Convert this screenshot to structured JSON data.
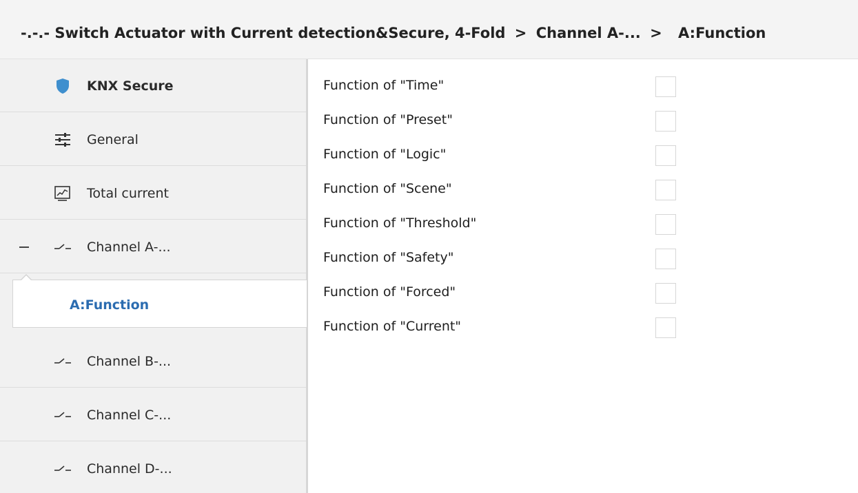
{
  "breadcrumb": {
    "device": "-.-.- Switch Actuator with Current detection&Secure, 4-Fold",
    "separator": ">",
    "channel": "Channel A-...",
    "current": "A:Function"
  },
  "sidebar": {
    "items": [
      {
        "label": "KNX Secure",
        "icon": "shield-icon"
      },
      {
        "label": "General",
        "icon": "sliders-icon"
      },
      {
        "label": "Total current",
        "icon": "chart-icon"
      },
      {
        "label": "Channel A-...",
        "icon": "switch-icon",
        "expanded": true
      },
      {
        "label": "A:Function",
        "selected": true
      },
      {
        "label": "Channel B-...",
        "icon": "switch-icon"
      },
      {
        "label": "Channel C-...",
        "icon": "switch-icon"
      },
      {
        "label": "Channel D-...",
        "icon": "switch-icon"
      }
    ]
  },
  "functions": [
    {
      "label": "Function of \"Time\"",
      "checked": false
    },
    {
      "label": "Function of \"Preset\"",
      "checked": false
    },
    {
      "label": "Function of \"Logic\"",
      "checked": false
    },
    {
      "label": "Function of \"Scene\"",
      "checked": false
    },
    {
      "label": "Function of \"Threshold\"",
      "checked": false
    },
    {
      "label": "Function of \"Safety\"",
      "checked": false
    },
    {
      "label": "Function of \"Forced\"",
      "checked": false
    },
    {
      "label": "Function of \"Current\"",
      "checked": false
    }
  ],
  "colors": {
    "accent": "#2b6cb0",
    "shield": "#3f8fce",
    "sidebar_bg": "#f1f1f1"
  }
}
